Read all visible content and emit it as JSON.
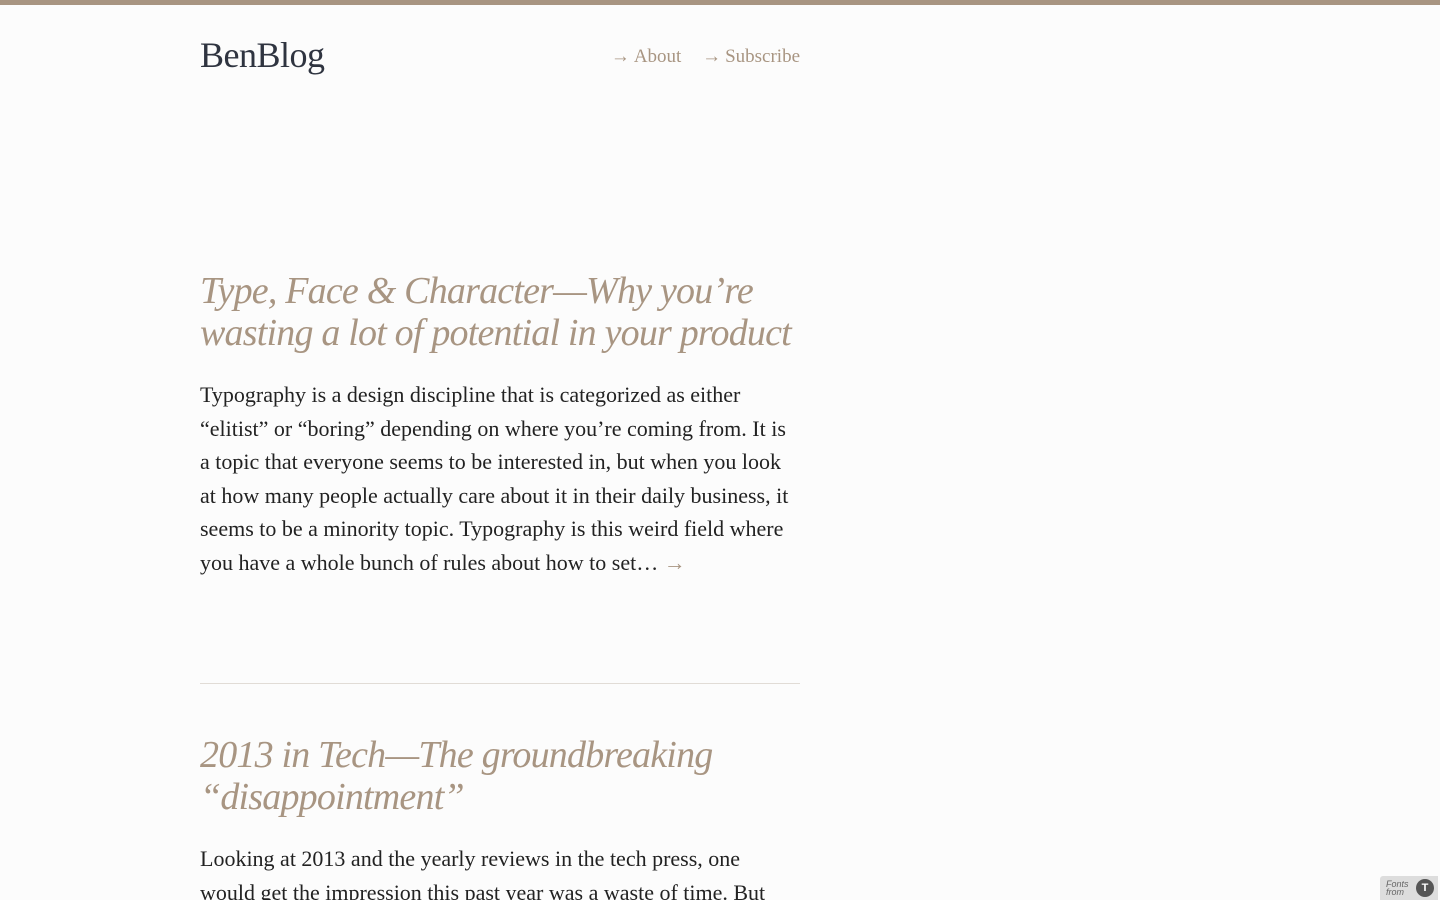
{
  "header": {
    "title": "BenBlog",
    "nav": [
      {
        "arrow": "→",
        "label": "About"
      },
      {
        "arrow": "→",
        "label": "Subscribe"
      }
    ]
  },
  "posts": [
    {
      "title": "Type, Face & Character—Why you’re wasting a lot of potential in your product",
      "excerpt": "Typography is a design discipline that is categorized as either “elitist” or “boring” depending on where you’re coming from. It is a topic that everyone seems to be interested in, but when you look at how many people actually care about it in their daily business, it seems to be a minority topic. Typography is this weird field where you have a whole bunch of rules about how to set…",
      "read_more": "→"
    },
    {
      "title": "2013 in Tech—The groundbreaking “disappointment”",
      "excerpt": "Looking at 2013 and the yearly reviews in the tech press, one would get the impression this past year was a waste of time. But"
    }
  ],
  "badge": {
    "text": "Fonts from",
    "logo": "T"
  },
  "colors": {
    "accent": "#a89582",
    "title": "#2f3440",
    "body_text": "#222222",
    "background": "#fcfcfc",
    "divider": "#e1dcd6"
  }
}
